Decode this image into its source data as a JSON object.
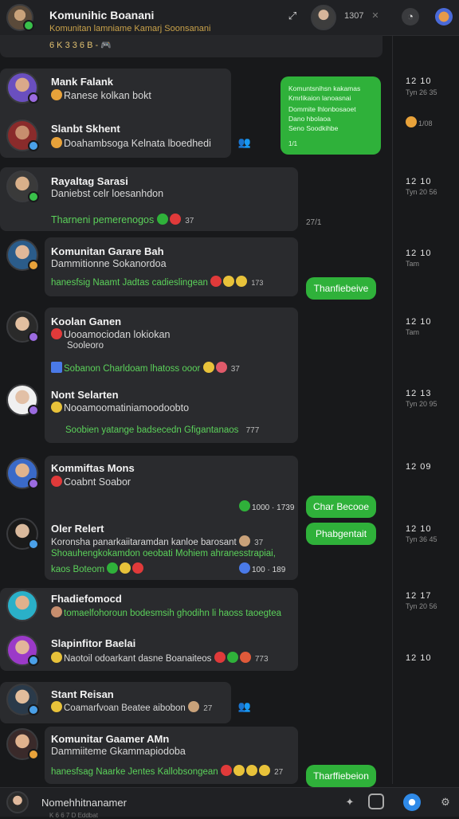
{
  "header": {
    "title": "Komunihic Boanani",
    "subtitle": "Komunitan lamniame Kamarj Soonsanani",
    "meta": "6 K 3 3 6 B - 🎮",
    "counter": "1307",
    "close_glyph": "✕",
    "pin_glyph": "⤢"
  },
  "messages": [
    {
      "name": "Mank Falank",
      "text": "Ranese kolkan bokt"
    },
    {
      "name": "Slanbt Skhent",
      "text": "Doahambsoga  Kelnata lboedhedi"
    },
    {
      "name": "Rayaltag Sarasi",
      "text": "Daniebst  celr loesanhdon"
    },
    {
      "name": "",
      "text": "Tharneni pemerenogos",
      "count": "37"
    },
    {
      "name": "Komunitan Garare Bah",
      "text": "Dammitionne Sokanordoa"
    },
    {
      "name": "",
      "text": "hanesfsig  Naamt Jadtas cadieslingean",
      "count": "173"
    },
    {
      "name": "Koolan Ganen",
      "text": "Uooamociodan lokiokan",
      "text2": "Sooleoro"
    },
    {
      "name": "",
      "text": "Sobanon Charldoam  lhatoss ooor",
      "count": "37"
    },
    {
      "name": "Nont Selarten",
      "text": "Nooamoomatiniamoodoobto"
    },
    {
      "name": "",
      "text": "Soobien yatange  badsecedn Gfigantanaos",
      "count": "777"
    },
    {
      "name": "Kommiftas Mons",
      "text": "Coabnt Soabor"
    },
    {
      "name": "",
      "text": "1000 · 1739"
    },
    {
      "name": "Oler Relert",
      "text": "Koronsha panarkaiitaramdan kanloe barosant",
      "count": "37"
    },
    {
      "name": "",
      "text": "Shoauhengkokamdon oeobati Mohiem ahranesstrapiai,"
    },
    {
      "name": "",
      "text": "kaos Boteom",
      "count": "100 · 189"
    },
    {
      "name": "Fhadiefomocd",
      "text": "tomaelfohoroun  bodesmsih  ghodihn  li haoss taoegtea"
    },
    {
      "name": "Slapinfitor Baelai",
      "text": "Naotoil odoarkant dasne  Boanaiteos",
      "count": "773"
    },
    {
      "name": "Stant Reisan",
      "text": "Coamarfvoan Beatee aibobon",
      "count": "27"
    },
    {
      "name": "Komunitar Gaamer AMn",
      "text": "Dammiiteme Gkammapiodoba"
    },
    {
      "name": "",
      "text": "hanesfsag  Naarke Jentes Kallobsongean",
      "count": "27"
    }
  ],
  "outgoing": {
    "bubble_lines": [
      "Komuntsnihsn kakamas",
      "Kmrlikaion lanoasnai",
      "Dommite lhlonbosaoet",
      "Dano hbolaoa",
      "Seno Soodkihbe"
    ],
    "bubble_time": "1/1",
    "pills": [
      "Thanfiebeive",
      "Char Becooe",
      "Phabgentait",
      "Tharffiebeion"
    ],
    "loose_time": "27/1"
  },
  "right_column": [
    {
      "time": "12 10",
      "sub": "Tyn 26 35"
    },
    {
      "time": "",
      "sub": "1/08"
    },
    {
      "time": "12 10",
      "sub": "Tyn 20 56"
    },
    {
      "time": "12 10",
      "sub": "Tam"
    },
    {
      "time": "12 10",
      "sub": "Tam"
    },
    {
      "time": "12 13",
      "sub": "Tyn 20 95"
    },
    {
      "time": "12 09",
      "sub": ""
    },
    {
      "time": "12 10",
      "sub": "Tyn 36 45"
    },
    {
      "time": "12 17",
      "sub": "Tyn 20 56"
    },
    {
      "time": "12 10",
      "sub": ""
    }
  ],
  "composer": {
    "placeholder": "Nomehhitnanamer",
    "sub": "K 6 6 7 D  Eddbat"
  },
  "colors": {
    "accent_green": "#2fb13a",
    "text_green": "#5bd15a",
    "card_bg": "#2a2b2e",
    "app_bg": "#18191b"
  }
}
